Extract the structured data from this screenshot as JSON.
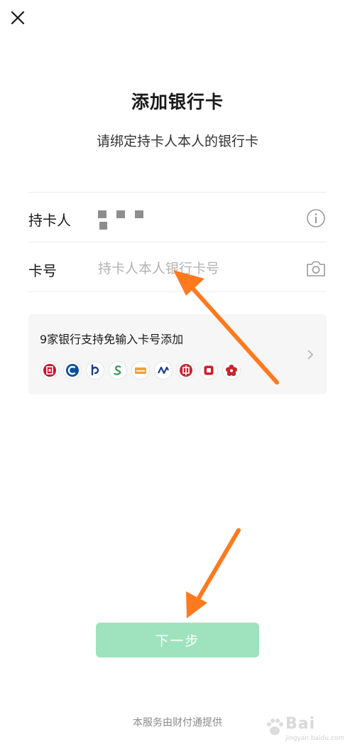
{
  "header": {
    "close_icon": "close-icon",
    "title": "添加银行卡",
    "subtitle": "请绑定持卡人本人的银行卡"
  },
  "form": {
    "holder_label": "持卡人",
    "holder_value_masked": true,
    "holder_info_icon": "info-circle-icon",
    "card_label": "卡号",
    "card_placeholder": "持卡人本人银行卡号",
    "card_value": "",
    "camera_icon": "camera-icon"
  },
  "bank_panel": {
    "text": "9家银行支持免输入卡号添加",
    "chevron_icon": "chevron-right-icon",
    "banks": [
      {
        "icon": "icbc-logo-icon",
        "color": "#c7162b"
      },
      {
        "icon": "ccb-logo-icon",
        "color": "#0a4f9e"
      },
      {
        "icon": "bank-of-communications-logo-icon",
        "color": "#1a3f8c"
      },
      {
        "icon": "spdb-s-logo-icon",
        "color": "#2d9a4a"
      },
      {
        "icon": "orange-bank-card-icon",
        "color": "#f0a23a"
      },
      {
        "icon": "spd-bank-logo-icon",
        "color": "#1d3f8f"
      },
      {
        "icon": "citic-logo-icon",
        "color": "#c8242f"
      },
      {
        "icon": "red-square-bank-logo-icon",
        "color": "#d21e2b"
      },
      {
        "icon": "flower-bank-logo-icon",
        "color": "#c8242f"
      }
    ]
  },
  "actions": {
    "next_label": "下一步",
    "next_color": "#9ee3bd"
  },
  "footer": {
    "note": "本服务由财付通提供"
  },
  "watermark": {
    "text": "Bai",
    "sub": "jingyan.baidu.com"
  },
  "annotations": {
    "arrow_color": "#ff7a1f"
  }
}
